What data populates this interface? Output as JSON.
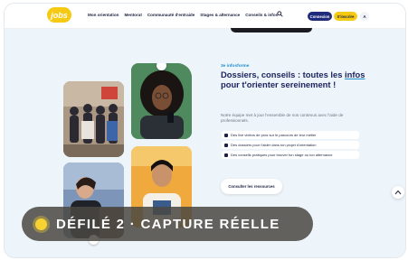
{
  "header": {
    "logo": "jobs",
    "nav": [
      "Mon orientation",
      "Mentorat",
      "Communauté d'entraide",
      "Stages & alternance",
      "Conseils & infos"
    ],
    "connect_label": "Connexion",
    "signup_label": "S'inscrire",
    "lang": "A"
  },
  "section": {
    "kicker": "3e infosforme",
    "title_part1": "Dossiers, conseils : toutes les ",
    "title_link": "infos",
    "title_part2": " pour t'orienter sereinement !",
    "description": "Notre équipe met à jour l'ensemble de nos contenus avec l'aide de professionnels.",
    "resources": [
      "Des live vidéos de pros sur le parcours de leur métier",
      "Des dossiers pour t'aider dans ton projet d'orientation",
      "Des conseils pratiques pour trouver ton stage ou ton alternance"
    ],
    "cta": "Consulter les ressources"
  },
  "overlay": {
    "label": "DÉFILÉ 2 · CAPTURE RÉELLE"
  },
  "colors": {
    "accent_yellow": "#f6c913",
    "navy": "#1d2560",
    "link_blue": "#1e8fd1",
    "page_bg": "#eef5fa"
  },
  "icons": [
    "search-icon",
    "camera-icon",
    "chevron-up-icon",
    "document-icon"
  ]
}
